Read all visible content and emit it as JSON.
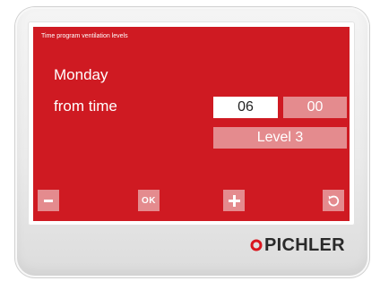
{
  "screen": {
    "title": "Time program ventilation levels",
    "day": "Monday",
    "from_label": "from time",
    "hour": "06",
    "minute": "00",
    "level": "Level 3"
  },
  "buttons": {
    "minus_icon": "minus-icon",
    "ok_label": "OK",
    "plus_icon": "plus-icon",
    "undo_icon": "undo-icon"
  },
  "brand": {
    "name": "PICHLER",
    "logo_icon": "ring-logo-icon"
  },
  "colors": {
    "screen_bg": "#cf1a22",
    "field_active": "#ffffff",
    "field_inactive": "#e48b8e",
    "brand_accent": "#d9161e",
    "housing": "#ececec"
  }
}
